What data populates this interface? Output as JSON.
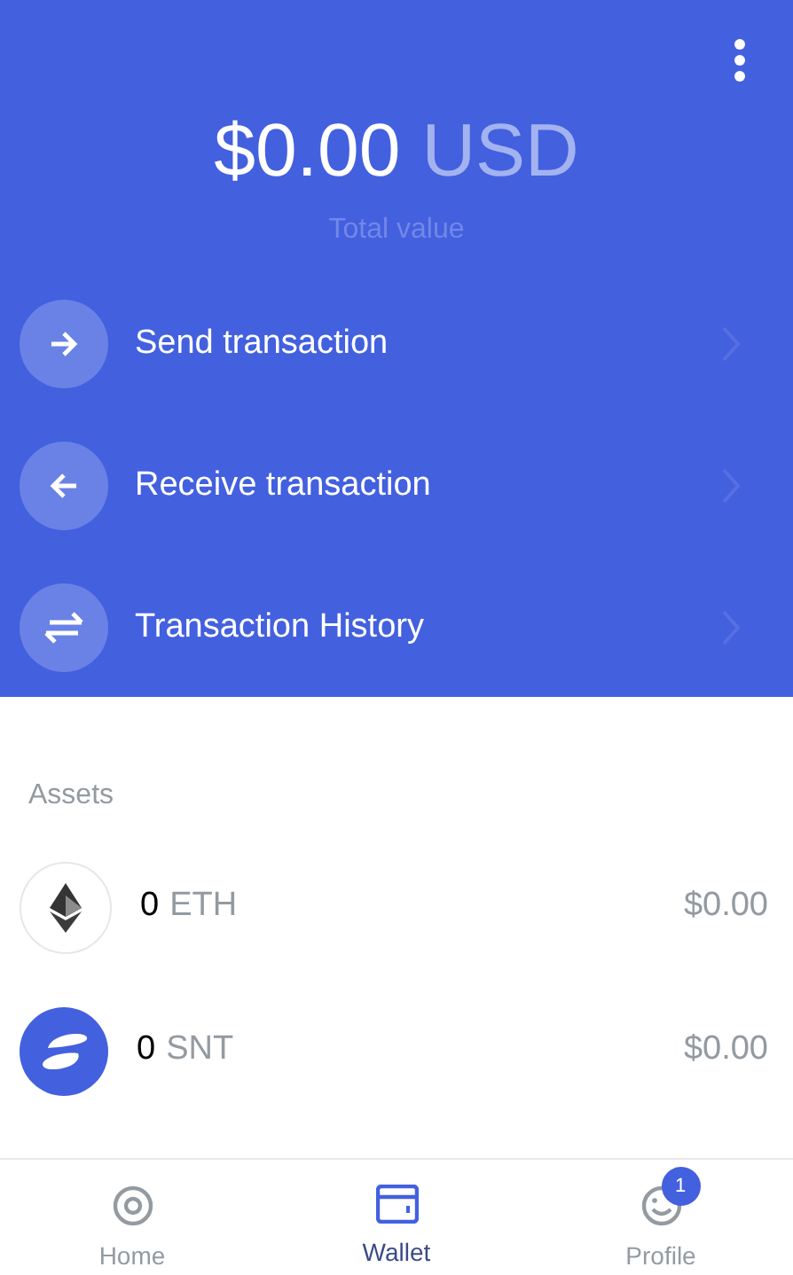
{
  "balance": {
    "amount": "$0.00",
    "currency": "USD",
    "caption": "Total value"
  },
  "actions": [
    {
      "kind": "send",
      "label": "Send transaction"
    },
    {
      "kind": "receive",
      "label": "Receive transaction"
    },
    {
      "kind": "history",
      "label": "Transaction History"
    }
  ],
  "assets": {
    "title": "Assets",
    "items": [
      {
        "kind": "eth",
        "amount": "0",
        "symbol": "ETH",
        "value": "$0.00"
      },
      {
        "kind": "snt",
        "amount": "0",
        "symbol": "SNT",
        "value": "$0.00"
      }
    ]
  },
  "tabs": [
    {
      "kind": "home",
      "label": "Home",
      "selected": false
    },
    {
      "kind": "wallet",
      "label": "Wallet",
      "selected": true
    },
    {
      "kind": "profile",
      "label": "Profile",
      "selected": false,
      "badge": "1"
    }
  ]
}
